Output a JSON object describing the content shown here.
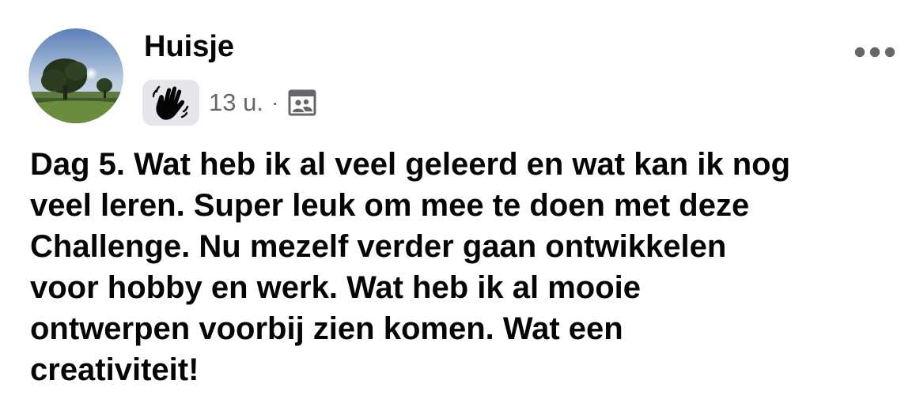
{
  "post": {
    "author_name": "Huisje",
    "timestamp": "13 u.",
    "separator": "·",
    "audience_icon": "friends-icon",
    "reaction_badge_icon": "waving-hand-icon",
    "more_icon": "more-options-icon",
    "text_lines": [
      "Dag 5. Wat heb ik al veel geleerd en wat kan ik nog",
      "veel leren. Super leuk om mee te doen met deze",
      "Challenge. Nu mezelf verder gaan ontwikkelen",
      "voor hobby en werk. Wat heb ik al mooie",
      "ontwerpen voorbij zien komen. Wat een",
      "creativiteit!"
    ]
  },
  "colors": {
    "text_primary": "#050505",
    "text_secondary": "#65676b",
    "badge_background": "#e4e6eb"
  }
}
